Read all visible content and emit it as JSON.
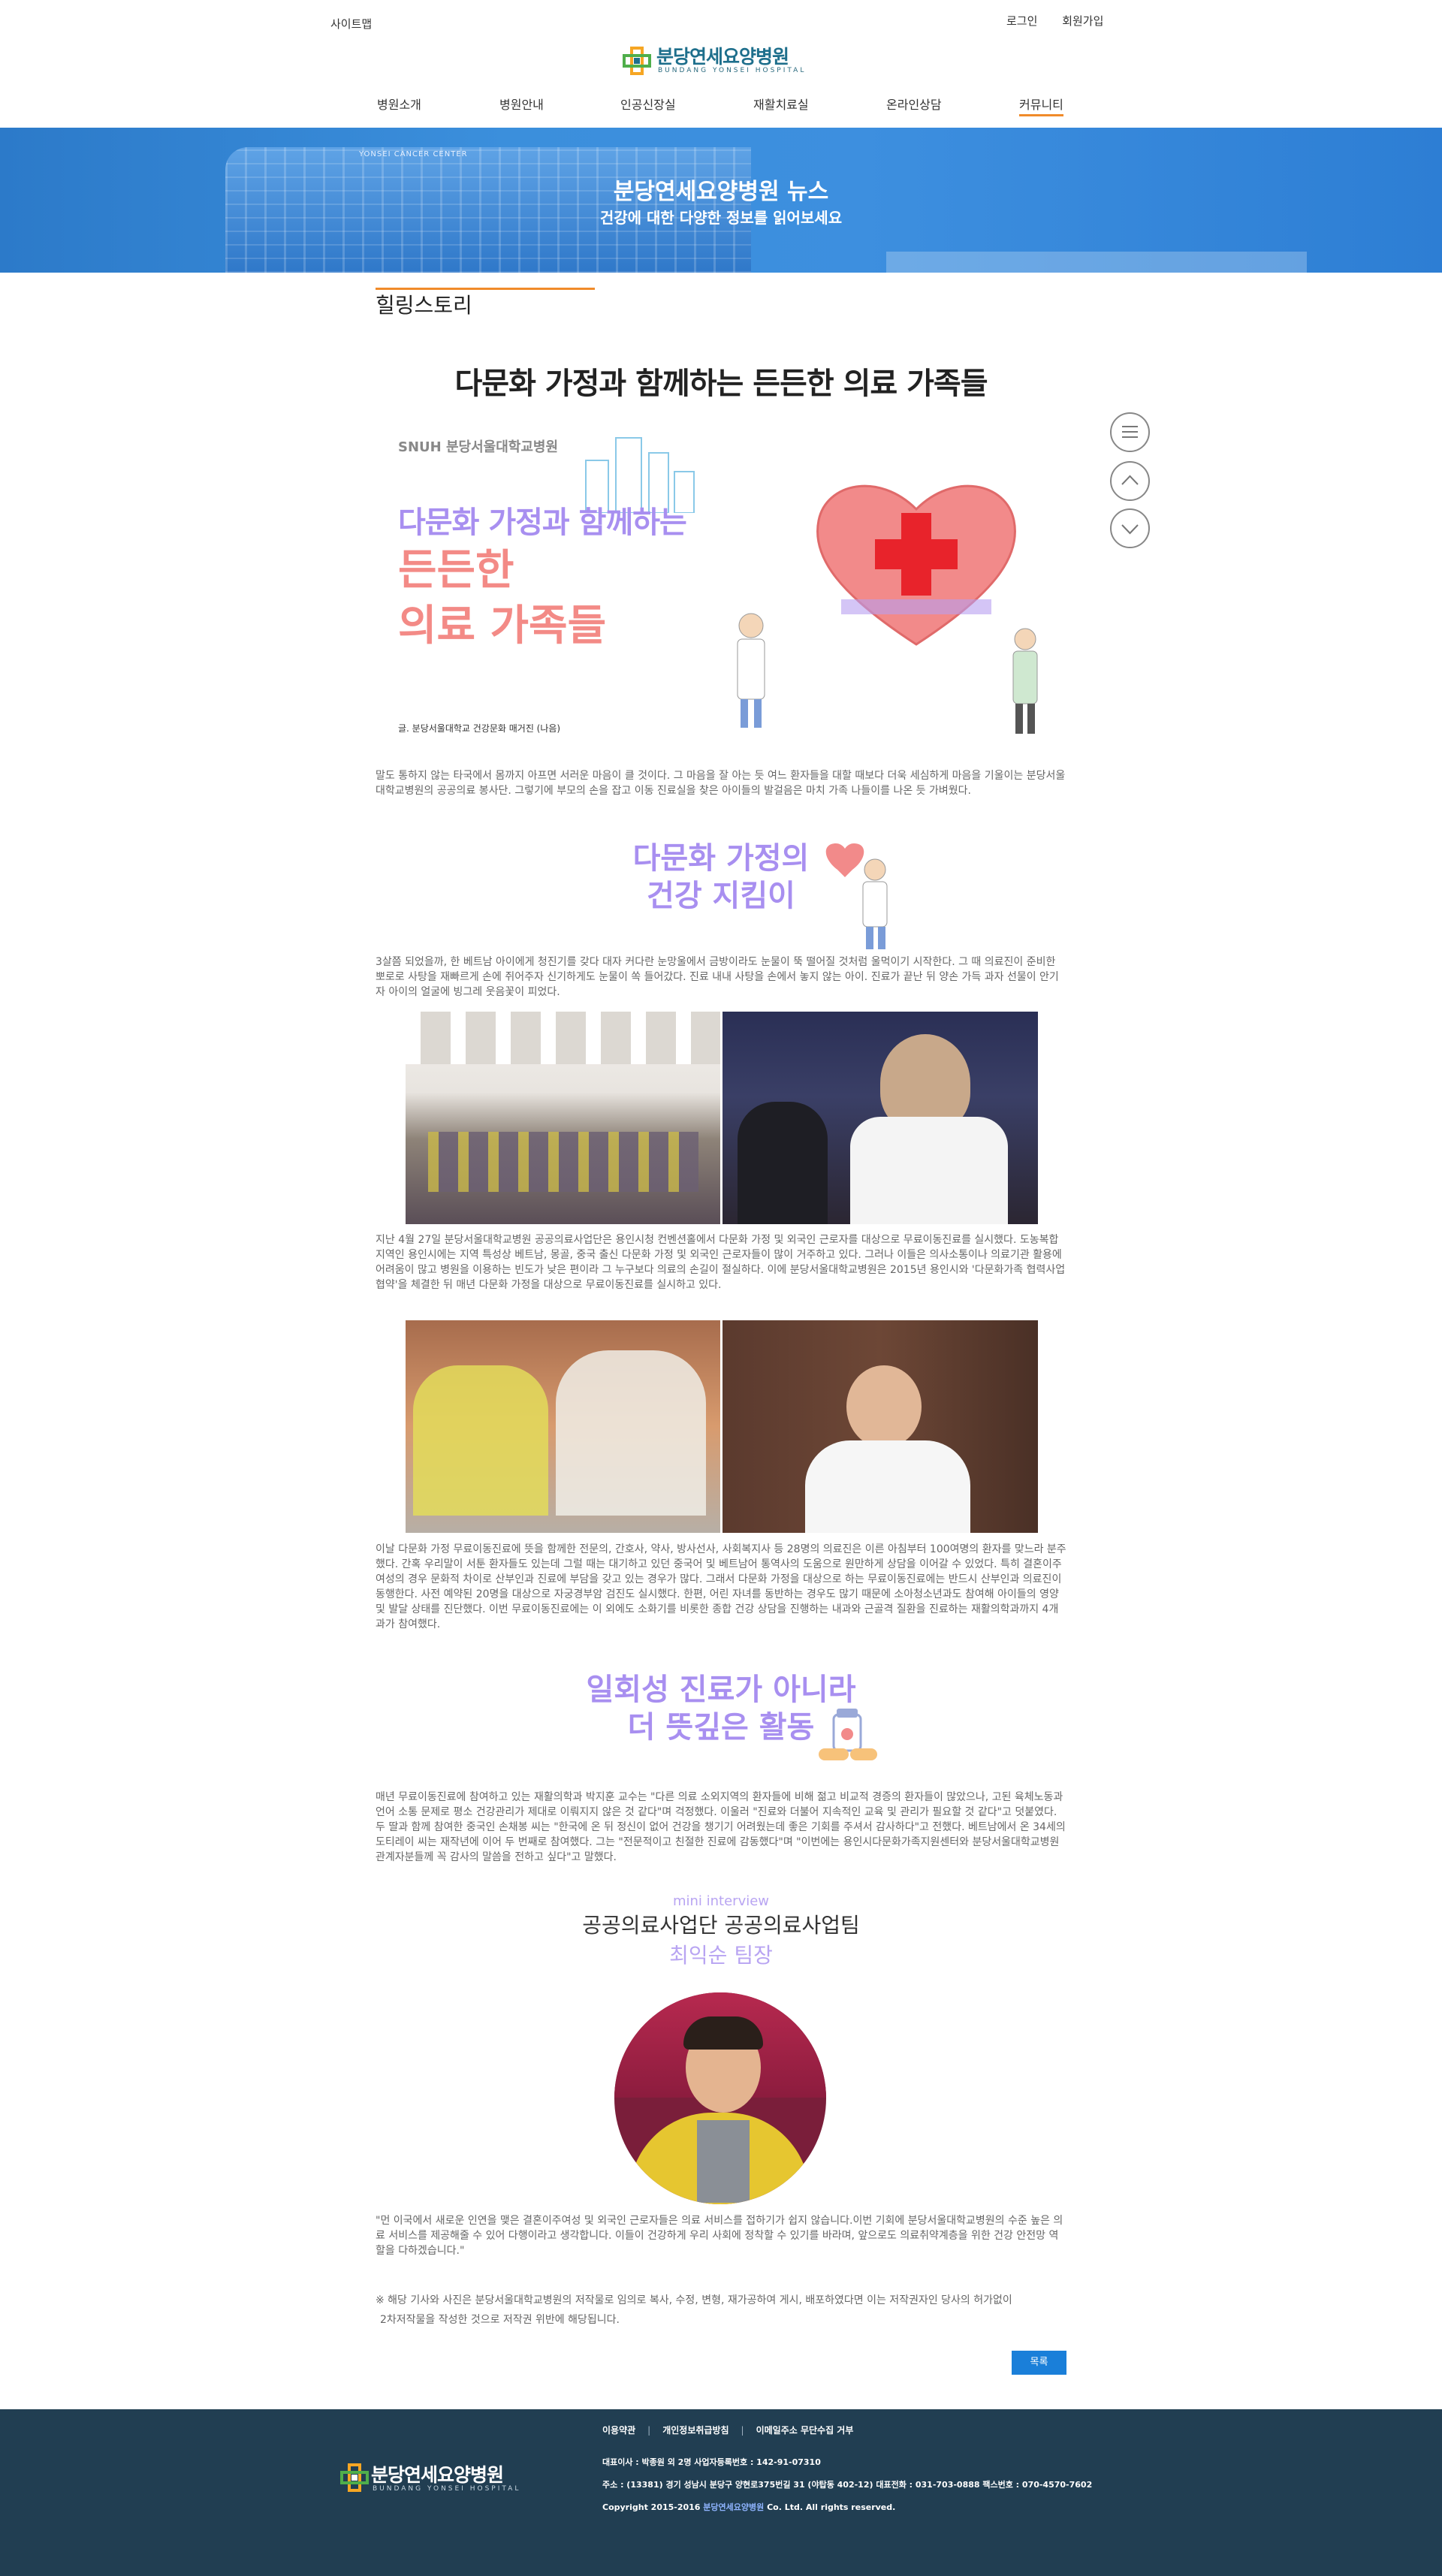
{
  "header": {
    "sitemap": "사이트맵",
    "login": "로그인",
    "join": "회원가입",
    "logo_kr": "분당연세요양병원",
    "logo_en": "BUNDANG YONSEI HOSPITAL",
    "nav": [
      "병원소개",
      "병원안내",
      "인공신장실",
      "재활치료실",
      "온라인상담",
      "커뮤니티"
    ],
    "active_nav": "커뮤니티"
  },
  "banner": {
    "title": "분당연세요양병원 뉴스",
    "subtitle": "건강에 대한 다양한 정보를 읽어보세요",
    "building_sign": "YONSEI CANCER CENTER"
  },
  "section": {
    "title": "힐링스토리"
  },
  "article": {
    "title": "다문화 가정과 함께하는 든든한 의료 가족들",
    "hero": {
      "org": "SNUH 분당서울대학교병원",
      "line1": "다문화 가정과 함께하는",
      "line2": "든든한",
      "line3": "의료 가족들",
      "credit": "글. 분당서울대학교 건강문화 매거진 (나음)"
    },
    "p1": "말도 통하지 않는 타국에서 몸까지 아프면 서러운 마음이 클 것이다. 그 마음을 잘 아는 듯 여느 환자들을 대할 때보다 더욱 세심하게 마음을 기울이는 분당서울대학교병원의 공공의료 봉사단. 그렇기에 부모의 손을 잡고 이동 진료실을 찾은 아이들의 발걸음은 마치 가족 나들이를 나온 듯 가벼웠다.",
    "subhead1_line1": "다문화 가정의",
    "subhead1_line2": "건강 지킴이",
    "p2": "3살쯤 되었을까, 한 베트남 아이에게 청진기를 갖다 대자 커다란 눈망울에서 금방이라도 눈물이 뚝 떨어질 것처럼 울먹이기 시작한다. 그 때 의료진이 준비한 뽀로로 사탕을 재빠르게 손에 쥐어주자 신기하게도 눈물이 쏙 들어갔다. 진료 내내 사탕을 손에서 놓지 않는 아이. 진료가 끝난 뒤 양손 가득 과자 선물이 안기자 아이의 얼굴에 빙그레 웃음꽃이 피었다.",
    "p3": "지난 4월 27일 분당서울대학교병원 공공의료사업단은 용인시청 컨벤션홀에서 다문화 가정 및 외국인 근로자를 대상으로 무료이동진료를 실시했다. 도농복합지역인 용인시에는 지역 특성상 베트남, 몽골, 중국 출신 다문화 가정 및 외국인 근로자들이 많이 거주하고 있다. 그러나 이들은 의사소통이나 의료기관 활용에 어려움이 많고 병원을 이용하는 빈도가 낮은 편이라 그 누구보다 의료의 손길이 절실하다. 이에 분당서울대학교병원은 2015년 용인시와 '다문화가족 협력사업 협약'을 체결한 뒤 매년 다문화 가정을 대상으로 무료이동진료를 실시하고 있다.",
    "p4": "이날 다문화 가정 무료이동진료에 뜻을 함께한 전문의, 간호사, 약사, 방사선사, 사회복지사 등 28명의 의료진은 이른 아침부터 100여명의 환자를 맞느라 분주했다. 간혹 우리말이 서툰 환자들도 있는데 그럴 때는 대기하고 있던 중국어 및 베트남어 통역사의 도움으로 원만하게 상담을 이어갈 수 있었다. 특히 결혼이주여성의 경우 문화적 차이로 산부인과 진료에 부담을 갖고 있는 경우가 많다. 그래서 다문화 가정을 대상으로 하는 무료이동진료에는 반드시 산부인과 의료진이 동행한다. 사전 예약된 20명을 대상으로 자궁경부암 검진도 실시했다. 한편, 어린 자녀를 동반하는 경우도 많기 때문에 소아청소년과도 참여해 아이들의 영양 및 발달 상태를 진단했다. 이번 무료이동진료에는 이 외에도 소화기를 비롯한 종합 건강 상담을 진행하는 내과와 근골격 질환을 진료하는 재활의학과까지 4개 과가 참여했다.",
    "subhead2_line1": "일회성 진료가 아니라",
    "subhead2_line2": "더 뜻깊은 활동",
    "p5": "매년 무료이동진료에 참여하고 있는 재활의학과 박지훈 교수는 \"다른 의료 소외지역의 환자들에 비해 젊고 비교적 경증의 환자들이 많았으나, 고된 육체노동과 언어 소통 문제로 평소 건강관리가 제대로 이뤄지지 않은 것 같다\"며 걱정했다. 이울러 \"진료와 더불어 지속적인 교육 및 관리가 필요할 것 같다\"고 덧붙였다. 두 딸과 함께 참여한 중국인 손채봉 씨는 \"한국에 온 뒤 정신이 없어 건강을 챙기기 어려웠는데 좋은 기회를 주셔서 감사하다\"고 전했다. 베트남에서 온 34세의 도티레이 씨는 재작년에 이어 두 번째로 참여했다. 그는 \"전문적이고 친절한 진료에 감동했다\"며 \"이번에는 용인시다문화가족지원센터와 분당서울대학교병원 관계자분들께 꼭 감사의 말씀을 전하고 싶다\"고 말했다.",
    "mini_label": "mini interview",
    "mini_name1": "공공의료사업단 공공의료사업팀",
    "mini_name2": "최익순 팀장",
    "p6": "\"먼 이국에서 새로운 인연을 맺은 결혼이주여성 및 외국인 근로자들은 의료 서비스를 접하기가 쉽지 않습니다.이번 기회에 분당서울대학교병원의 수준 높은 의료 서비스를 제공해줄 수 있어 다행이라고 생각합니다. 이들이 건강하게 우리 사회에 정착할 수 있기를 바라며, 앞으로도 의료취약계층을 위한 건강 안전망 역할을 다하겠습니다.\"",
    "notice1": "※ 해당 기사와 사진은 분당서울대학교병원의 저작물로 임의로 복사, 수정, 변형, 재가공하여 게시, 배포하였다면 이는 저작권자인 당사의 허가없이",
    "notice2": "2차저작물을 작성한 것으로 저작권 위반에 해당됩니다.",
    "list_button": "목록"
  },
  "quick_icons": [
    "menu-icon",
    "arrow-up-icon",
    "arrow-down-icon"
  ],
  "footer": {
    "links": [
      "이용약관",
      "개인정보취급방침",
      "이메일주소 무단수집 거부"
    ],
    "line1": "대표이사 : 박종원 외 2명 사업자등록번호 : 142-91-07310",
    "line2": "주소 : (13381) 경기 성남시 분당구 양현로375번길 31 (야탑동 402-12)  대표전화 : 031-703-0888  팩스번호 : 070-4570-7602",
    "copy_a": "Copyright 2015-2016 ",
    "copy_b": "분당연세요양병원",
    "copy_c": " Co. Ltd. All rights reserved.",
    "logo_kr": "분당연세요양병원",
    "logo_en": "BUNDANG YONSEI HOSPITAL"
  },
  "colors": {
    "accent_orange": "#f08b2a",
    "banner_blue": "#3b8fdc",
    "lavender": "#a88ff0",
    "pink": "#f38a86",
    "footer_navy": "#213e52",
    "button_blue": "#1a7fd9"
  }
}
